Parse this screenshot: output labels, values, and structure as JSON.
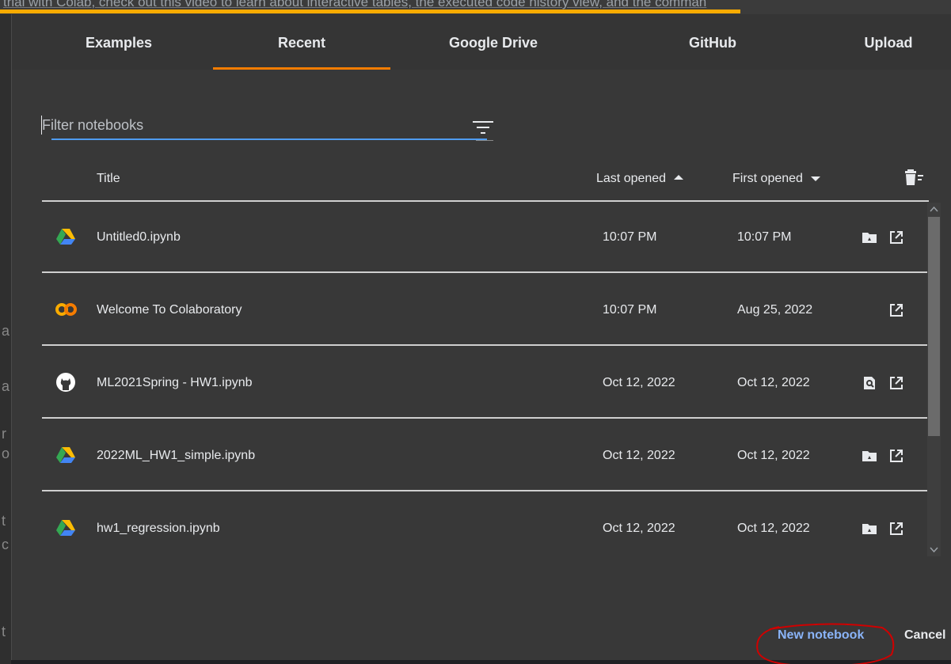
{
  "background": {
    "strip_text": "trial with Colab, check out this video to learn about interactive tables, the executed code history view, and the comman"
  },
  "tabs": [
    {
      "label": "Examples",
      "active": false
    },
    {
      "label": "Recent",
      "active": true
    },
    {
      "label": "Google Drive",
      "active": false
    },
    {
      "label": "GitHub",
      "active": false
    },
    {
      "label": "Upload",
      "active": false
    }
  ],
  "filter": {
    "placeholder": "Filter notebooks",
    "value": ""
  },
  "table": {
    "headers": {
      "title": "Title",
      "last_opened": "Last opened",
      "first_opened": "First opened"
    },
    "rows": [
      {
        "source": "drive-icon",
        "title": "Untitled0.ipynb",
        "last_opened": "10:07 PM",
        "first_opened": "10:07 PM",
        "actions": [
          "drive-folder-icon",
          "open-in-new-tab-icon"
        ]
      },
      {
        "source": "colab-icon",
        "title": "Welcome To Colaboratory",
        "last_opened": "10:07 PM",
        "first_opened": "Aug 25, 2022",
        "actions": [
          "open-in-new-tab-icon"
        ]
      },
      {
        "source": "github-icon",
        "title": "ML2021Spring - HW1.ipynb",
        "last_opened": "Oct 12, 2022",
        "first_opened": "Oct 12, 2022",
        "actions": [
          "view-source-icon",
          "open-in-new-tab-icon"
        ]
      },
      {
        "source": "drive-icon",
        "title": "2022ML_HW1_simple.ipynb",
        "last_opened": "Oct 12, 2022",
        "first_opened": "Oct 12, 2022",
        "actions": [
          "drive-folder-icon",
          "open-in-new-tab-icon"
        ]
      },
      {
        "source": "drive-icon",
        "title": "hw1_regression.ipynb",
        "last_opened": "Oct 12, 2022",
        "first_opened": "Oct 12, 2022",
        "actions": [
          "drive-folder-icon",
          "open-in-new-tab-icon"
        ]
      }
    ]
  },
  "footer": {
    "new_notebook": "New notebook",
    "cancel": "Cancel"
  },
  "colors": {
    "active_tab_indicator": "#f57c00",
    "filter_focus": "#4f9cf0",
    "primary_button": "#8ab4f8",
    "annotation_circle": "#d00000"
  }
}
